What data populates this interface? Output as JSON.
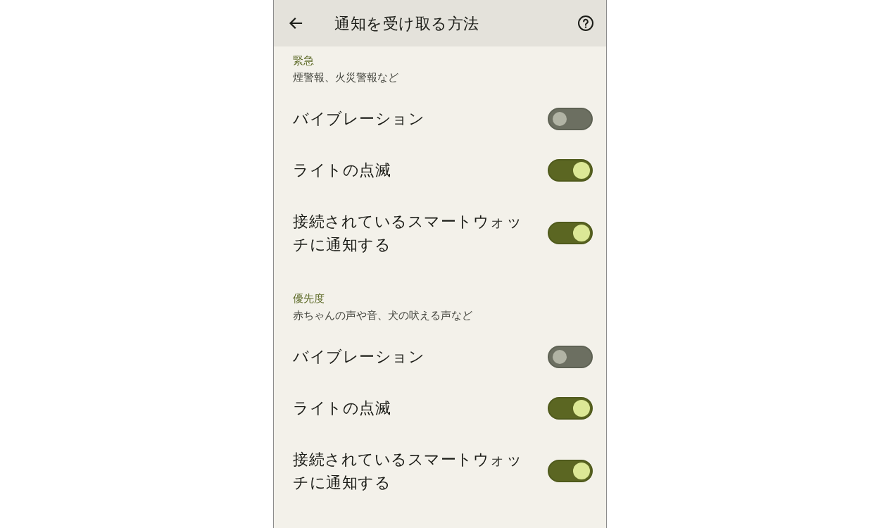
{
  "app_bar": {
    "title": "通知を受け取る方法"
  },
  "sections": [
    {
      "title": "緊急",
      "subtitle": "煙警報、火災警報など",
      "settings": [
        {
          "label": "バイブレーション",
          "on": false
        },
        {
          "label": "ライトの点滅",
          "on": true
        },
        {
          "label": "接続されているスマートウォッチに通知する",
          "on": true
        }
      ]
    },
    {
      "title": "優先度",
      "subtitle": "赤ちゃんの声や音、犬の吠える声など",
      "settings": [
        {
          "label": "バイブレーション",
          "on": false
        },
        {
          "label": "ライトの点滅",
          "on": true
        },
        {
          "label": "接続されているスマートウォッチに通知する",
          "on": true
        }
      ]
    }
  ]
}
